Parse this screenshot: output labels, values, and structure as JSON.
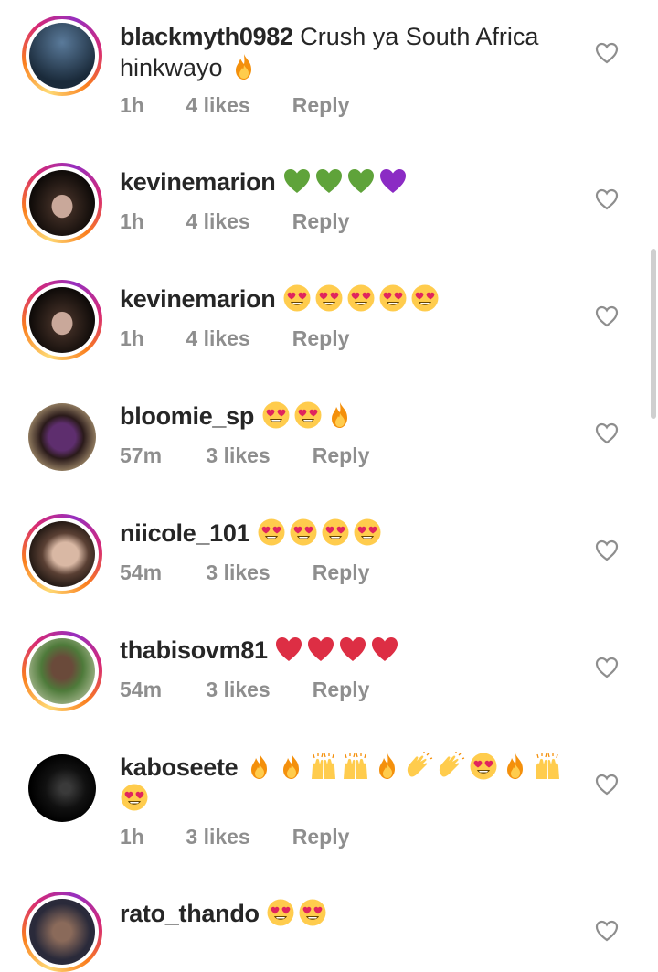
{
  "comments": [
    {
      "username": "blackmyth0982",
      "text": "Crush ya South Africa hinkwayo",
      "emojis": [
        "fire"
      ],
      "time": "1h",
      "likes": "4 likes",
      "reply": "Reply"
    },
    {
      "username": "kevinemarion",
      "text": "",
      "emojis": [
        "green-heart",
        "green-heart",
        "green-heart",
        "purple-heart"
      ],
      "time": "1h",
      "likes": "4 likes",
      "reply": "Reply"
    },
    {
      "username": "kevinemarion",
      "text": "",
      "emojis": [
        "heart-eyes",
        "heart-eyes",
        "heart-eyes",
        "heart-eyes",
        "heart-eyes"
      ],
      "time": "1h",
      "likes": "4 likes",
      "reply": "Reply"
    },
    {
      "username": "bloomie_sp",
      "text": "",
      "emojis": [
        "heart-eyes",
        "heart-eyes",
        "fire"
      ],
      "time": "57m",
      "likes": "3 likes",
      "reply": "Reply"
    },
    {
      "username": "niicole_101",
      "text": "",
      "emojis": [
        "heart-eyes",
        "heart-eyes",
        "heart-eyes",
        "heart-eyes"
      ],
      "time": "54m",
      "likes": "3 likes",
      "reply": "Reply"
    },
    {
      "username": "thabisovm81",
      "text": "",
      "emojis": [
        "red-heart",
        "red-heart",
        "red-heart",
        "red-heart"
      ],
      "time": "54m",
      "likes": "3 likes",
      "reply": "Reply"
    },
    {
      "username": "kaboseete",
      "text": "",
      "emojis": [
        "fire",
        "fire",
        "raised-hands",
        "raised-hands",
        "fire",
        "clapping-hands",
        "clapping-hands",
        "heart-eyes",
        "fire",
        "raised-hands",
        "heart-eyes"
      ],
      "time": "1h",
      "likes": "3 likes",
      "reply": "Reply"
    },
    {
      "username": "rato_thando",
      "text": "",
      "emojis": [
        "heart-eyes",
        "heart-eyes"
      ],
      "time": "",
      "likes": "",
      "reply": ""
    }
  ],
  "icons": {
    "like": "heart-outline-icon"
  },
  "colors": {
    "username": "#262626",
    "meta": "#8e8e8e",
    "ring": "#d62976"
  }
}
